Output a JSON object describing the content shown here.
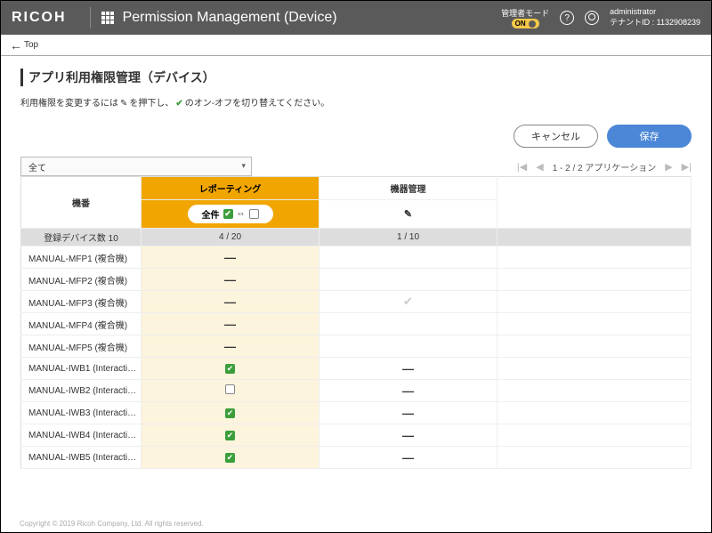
{
  "header": {
    "brand": "RICOH",
    "title": "Permission Management (Device)",
    "mode_label": "管理者モード",
    "mode_toggle": "ON",
    "user_name": "administrator",
    "tenant": "テナントID : 1132908239"
  },
  "back": {
    "label": "Top"
  },
  "page": {
    "title": "アプリ利用権限管理（デバイス）",
    "instruction_pre": "利用権限を変更するには",
    "instruction_mid": "を押下し、",
    "instruction_post": "のオン-オフを切り替えてください。"
  },
  "buttons": {
    "cancel": "キャンセル",
    "save": "保存"
  },
  "filter": {
    "value": "全て"
  },
  "pager": {
    "text": "1 - 2 / 2 アプリケーション"
  },
  "columns": {
    "model": "機番",
    "report": "レポーティング",
    "device": "機器管理",
    "all_label": "全件",
    "swap": "⇔"
  },
  "counts": {
    "devices": "登録デバイス数 10",
    "report": "4 / 20",
    "device": "1 / 10"
  },
  "rows": [
    {
      "name": "MANUAL-MFP1 (複合機)",
      "report": "dash",
      "device": ""
    },
    {
      "name": "MANUAL-MFP2 (複合機)",
      "report": "dash",
      "device": ""
    },
    {
      "name": "MANUAL-MFP3 (複合機)",
      "report": "dash",
      "device": "check-gray"
    },
    {
      "name": "MANUAL-MFP4 (複合機)",
      "report": "dash",
      "device": ""
    },
    {
      "name": "MANUAL-MFP5 (複合機)",
      "report": "dash",
      "device": ""
    },
    {
      "name": "MANUAL-IWB1 (Interacti…",
      "report": "check",
      "device": "dash"
    },
    {
      "name": "MANUAL-IWB2 (Interacti…",
      "report": "empty",
      "device": "dash"
    },
    {
      "name": "MANUAL-IWB3 (Interacti…",
      "report": "check",
      "device": "dash"
    },
    {
      "name": "MANUAL-IWB4 (Interacti…",
      "report": "check",
      "device": "dash"
    },
    {
      "name": "MANUAL-IWB5 (Interacti…",
      "report": "check",
      "device": "dash"
    }
  ],
  "footer": "Copyright © 2019 Ricoh Company, Ltd. All rights reserved."
}
